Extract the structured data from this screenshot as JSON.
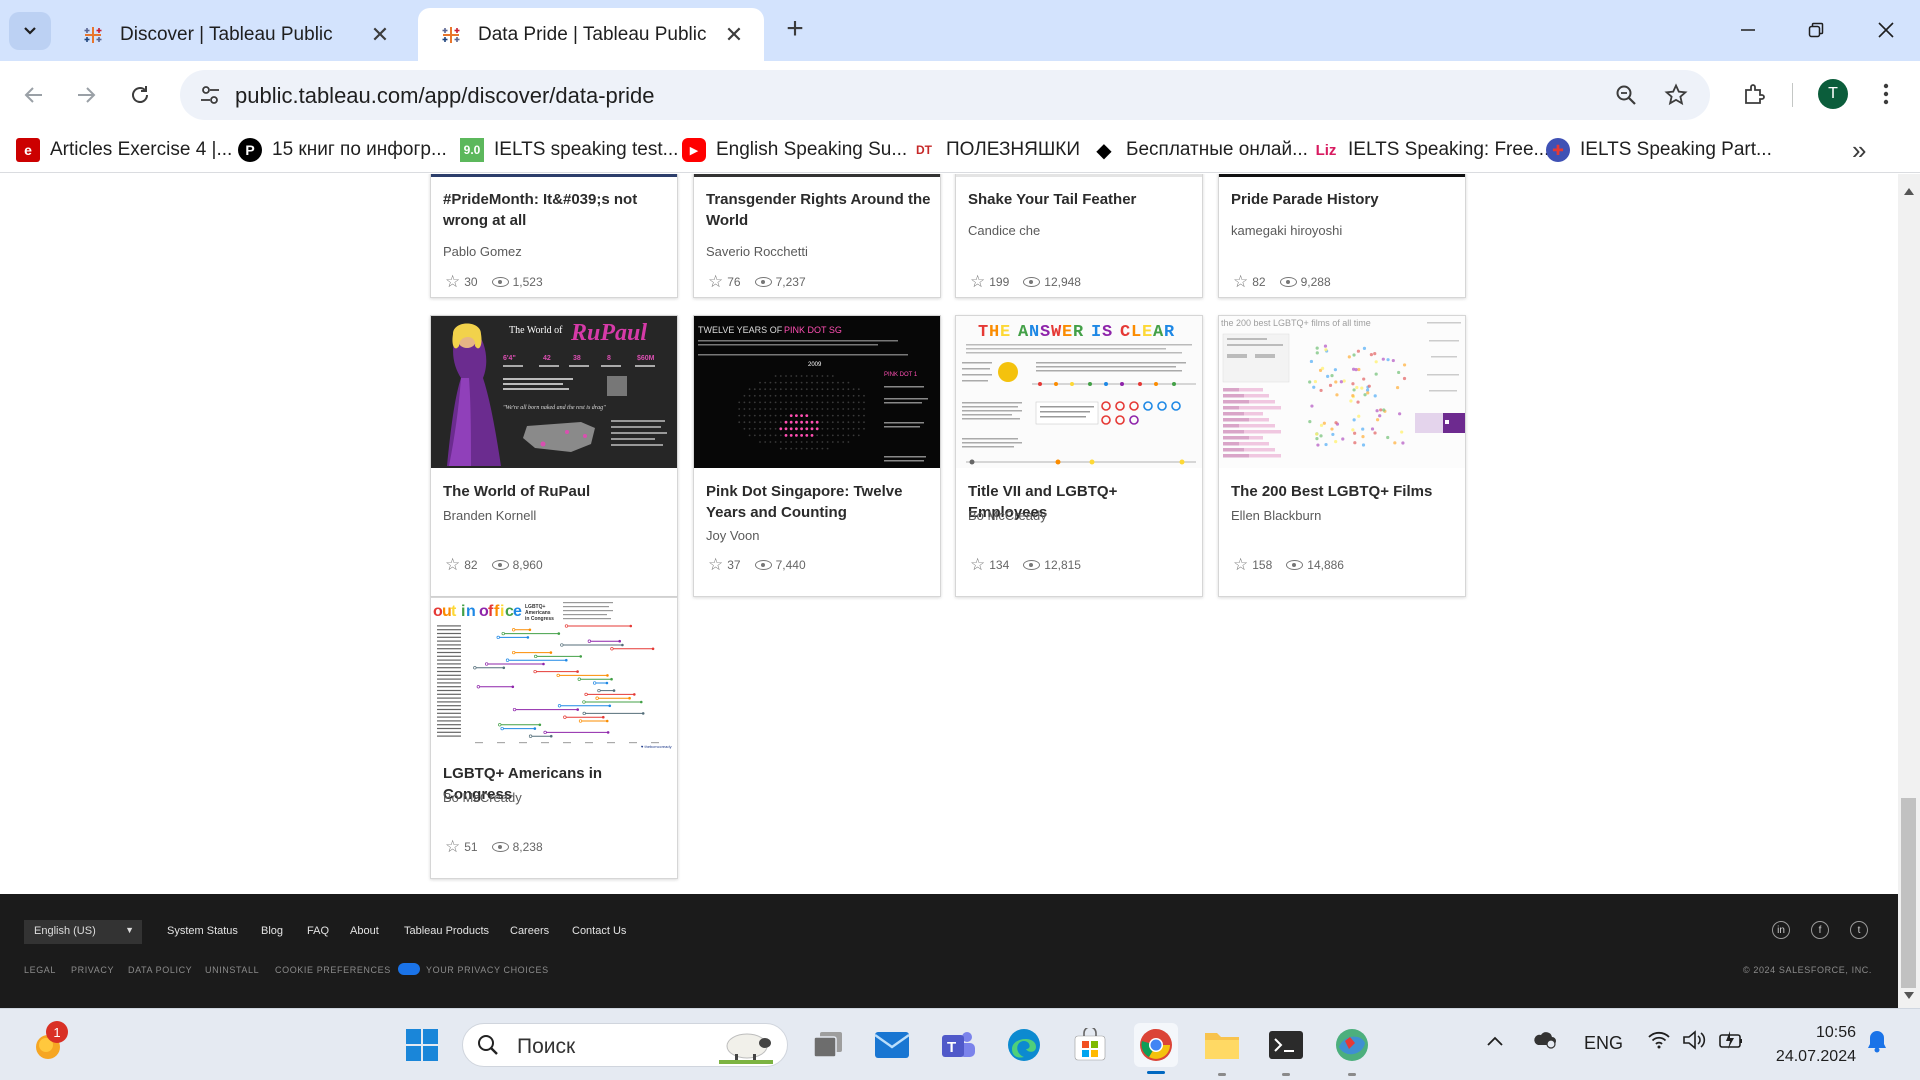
{
  "browser": {
    "tabs": [
      {
        "title": "Discover | Tableau Public",
        "active": false
      },
      {
        "title": "Data Pride | Tableau Public",
        "active": true
      }
    ],
    "url": "public.tableau.com/app/discover/data-pride",
    "profile_initial": "T",
    "bookmarks": [
      {
        "label": "Articles Exercise 4 |...",
        "icon_text": "e",
        "color": "#cc0000"
      },
      {
        "label": "15 книг по инфогр...",
        "icon_text": "P",
        "color": "#000000"
      },
      {
        "label": "IELTS speaking test...",
        "icon_text": "9.0",
        "color": "#5cb85c"
      },
      {
        "label": "English Speaking Su...",
        "icon_text": "▶",
        "color": "#ff0000"
      },
      {
        "label": "ПОЛЕЗНЯШКИ",
        "icon_text": "DT",
        "color": "#c62828"
      },
      {
        "label": "Бесплатные онлай...",
        "icon_text": "◆",
        "color": "#000000"
      },
      {
        "label": "IELTS Speaking: Free...",
        "icon_text": "Liz",
        "color": "#d81b60"
      },
      {
        "label": "IELTS Speaking Part...",
        "icon_text": "✚",
        "color": "#3f51b5"
      }
    ]
  },
  "cards_top": [
    {
      "title": "#PrideMonth: It&#039;s not wrong at all",
      "author": "Pablo Gomez",
      "favorites": "30",
      "views": "1,523",
      "strip": "#2c3e6b"
    },
    {
      "title": "Transgender Rights Around the World",
      "author": "Saverio Rocchetti",
      "favorites": "76",
      "views": "7,237",
      "strip": "#333333"
    },
    {
      "title": "Shake Your Tail Feather",
      "author": "Candice che",
      "favorites": "199",
      "views": "12,948",
      "strip": "#e0e0e0"
    },
    {
      "title": "Pride Parade History",
      "author": "kamegaki hiroyoshi",
      "favorites": "82",
      "views": "9,288",
      "strip": "#111111"
    }
  ],
  "cards_mid": [
    {
      "title": "The World of RuPaul",
      "author": "Branden Kornell",
      "favorites": "82",
      "views": "8,960",
      "thumb_heading": "The World of RuPaul"
    },
    {
      "title": "Pink Dot Singapore: Twelve Years and Counting",
      "author": "Joy Voon",
      "favorites": "37",
      "views": "7,440",
      "thumb_heading": "TWELVE YEARS OF PINK DOT SG"
    },
    {
      "title": "Title VII and LGBTQ+ Employees",
      "author": "Bo McCready",
      "favorites": "134",
      "views": "12,815",
      "thumb_heading": "THE ANSWER IS CLEAR"
    },
    {
      "title": "The 200 Best LGBTQ+ Films",
      "author": "Ellen Blackburn",
      "favorites": "158",
      "views": "14,886",
      "thumb_heading": "the 200 best LGBTQ+ films of all time"
    }
  ],
  "cards_bottom": [
    {
      "title": "LGBTQ+ Americans in Congress",
      "author": "Bo McCready",
      "favorites": "51",
      "views": "8,238",
      "thumb_heading": "out in office"
    }
  ],
  "footer": {
    "language": "English (US)",
    "links": [
      "System Status",
      "Blog",
      "FAQ",
      "About",
      "Tableau Products",
      "Careers",
      "Contact Us"
    ],
    "legal": [
      "LEGAL",
      "PRIVACY",
      "DATA POLICY",
      "UNINSTALL",
      "COOKIE PREFERENCES",
      "YOUR PRIVACY CHOICES"
    ],
    "copyright": "© 2024 SALESFORCE, INC."
  },
  "taskbar": {
    "search_placeholder": "Поиск",
    "notification_count": "1",
    "language": "ENG",
    "time": "10:56",
    "date": "24.07.2024"
  }
}
